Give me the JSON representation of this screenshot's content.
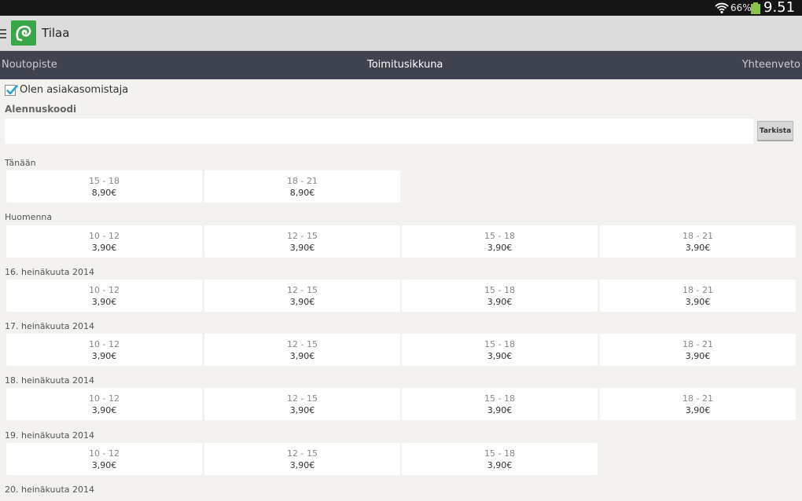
{
  "statusbar": {
    "battery_pct": "66%",
    "time": "9.51"
  },
  "actionbar": {
    "title": "Tilaa"
  },
  "tabs": [
    "Noutopiste",
    "Toimitusikkuna",
    "Yhteenveto"
  ],
  "owner_checkbox": {
    "label": "Olen asiakasomistaja",
    "checked": true
  },
  "discount": {
    "label": "Alennuskoodi",
    "value": "",
    "placeholder": "",
    "button": "Tarkista"
  },
  "days": [
    {
      "label": "Tänään",
      "slots": [
        {
          "time": "15 - 18",
          "price": "8,90€"
        },
        {
          "time": "18 - 21",
          "price": "8,90€"
        }
      ]
    },
    {
      "label": "Huomenna",
      "slots": [
        {
          "time": "10 - 12",
          "price": "3,90€"
        },
        {
          "time": "12 - 15",
          "price": "3,90€"
        },
        {
          "time": "15 - 18",
          "price": "3,90€"
        },
        {
          "time": "18 - 21",
          "price": "3,90€"
        }
      ]
    },
    {
      "label": "16. heinäkuuta 2014",
      "slots": [
        {
          "time": "10 - 12",
          "price": "3,90€"
        },
        {
          "time": "12 - 15",
          "price": "3,90€"
        },
        {
          "time": "15 - 18",
          "price": "3,90€"
        },
        {
          "time": "18 - 21",
          "price": "3,90€"
        }
      ]
    },
    {
      "label": "17. heinäkuuta 2014",
      "slots": [
        {
          "time": "10 - 12",
          "price": "3,90€"
        },
        {
          "time": "12 - 15",
          "price": "3,90€"
        },
        {
          "time": "15 - 18",
          "price": "3,90€"
        },
        {
          "time": "18 - 21",
          "price": "3,90€"
        }
      ]
    },
    {
      "label": "18. heinäkuuta 2014",
      "slots": [
        {
          "time": "10 - 12",
          "price": "3,90€"
        },
        {
          "time": "12 - 15",
          "price": "3,90€"
        },
        {
          "time": "15 - 18",
          "price": "3,90€"
        },
        {
          "time": "18 - 21",
          "price": "3,90€"
        }
      ]
    },
    {
      "label": "19. heinäkuuta 2014",
      "slots": [
        {
          "time": "10 - 12",
          "price": "3,90€"
        },
        {
          "time": "12 - 15",
          "price": "3,90€"
        },
        {
          "time": "15 - 18",
          "price": "3,90€"
        }
      ]
    },
    {
      "label": "20. heinäkuuta 2014",
      "slots": []
    }
  ]
}
